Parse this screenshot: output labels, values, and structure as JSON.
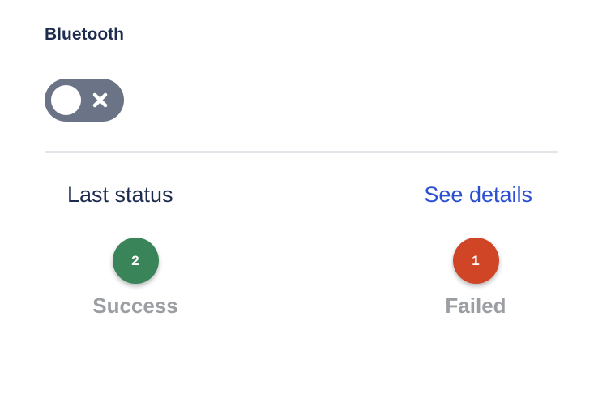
{
  "bluetooth": {
    "label": "Bluetooth",
    "toggle_on": false,
    "toggle_icon": "close-icon",
    "colors": {
      "track_off": "#6b7487",
      "knob": "#ffffff"
    }
  },
  "status": {
    "title": "Last status",
    "details_link": "See details",
    "link_color": "#2a4fd1",
    "success": {
      "count": "2",
      "label": "Success",
      "color": "#3a845a"
    },
    "failed": {
      "count": "1",
      "label": "Failed",
      "color": "#cf4526"
    }
  }
}
